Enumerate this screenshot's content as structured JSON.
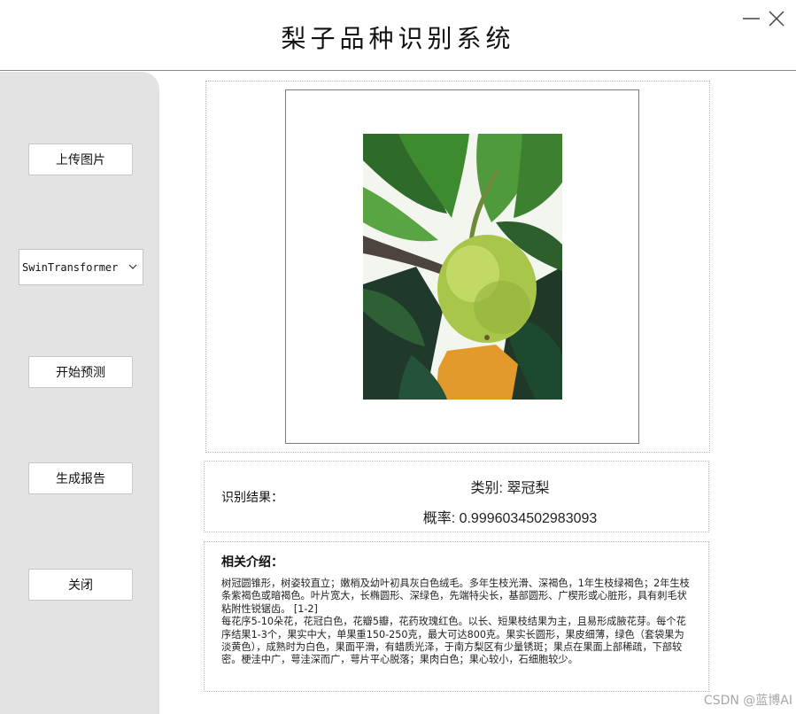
{
  "window": {
    "title": "梨子品种识别系统"
  },
  "sidebar": {
    "upload_label": "上传图片",
    "model_value": "SwinTransformer",
    "predict_label": "开始预测",
    "report_label": "生成报告",
    "close_label": "关闭"
  },
  "result": {
    "label": "识别结果：",
    "class_text": "类别: 翠冠梨",
    "prob_text": "概率: 0.9996034502983093"
  },
  "intro": {
    "heading": "相关介绍：",
    "text": "树冠圆锥形，树姿较直立；嫩梢及幼叶初具灰白色绒毛。多年生枝光滑、深褐色，1年生枝绿褐色；2年生枝条紫褐色或暗褐色。叶片宽大，长椭圆形、深绿色，先端特尖长，基部圆形、广楔形或心脏形，具有刺毛状粘附性锐锯齿。 [1-2]\n每花序5-10朵花，花冠白色，花瓣5瓣，花药玫瑰红色。以长、短果枝结果为主，且易形成腋花芽。每个花序结果1-3个，果实中大，单果重150-250克，最大可达800克。果实长圆形，果皮细薄，绿色（套袋果为淡黄色），成熟时为白色，果面平滑，有蜡质光泽，于南方梨区有少量锈斑；果点在果面上部稀疏，下部较密。梗洼中广，萼洼深而广，萼片平心脱落；果肉白色；果心较小，石细胞较少。"
  },
  "watermark": "CSDN @蓝博AI",
  "icons": {
    "minimize": "minimize-icon",
    "close": "close-icon",
    "dropdown": "chevron-down-icon"
  }
}
